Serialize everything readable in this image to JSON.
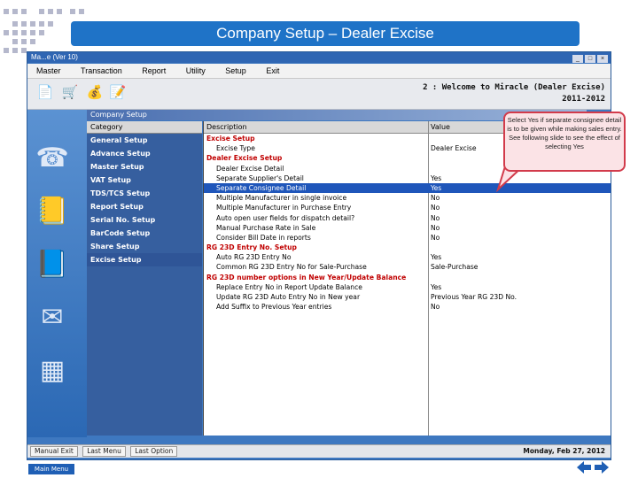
{
  "slide": {
    "title": "Company Setup – Dealer Excise",
    "main_menu_label": "Main Menu"
  },
  "window": {
    "title": "Ma...e (Ver 10)",
    "controls": [
      "_",
      "□",
      "×"
    ]
  },
  "menubar": [
    "Master",
    "Transaction",
    "Report",
    "Utility",
    "Setup",
    "Exit"
  ],
  "toolbar": {
    "icons": [
      "document-icon",
      "cart-icon",
      "money-bag-icon",
      "notepad-icon"
    ],
    "welcome_line1": "2 : Welcome to Miracle (Dealer Excise)",
    "welcome_line2": "2011-2012"
  },
  "panel": {
    "title": "Company Setup",
    "category_header": "Category",
    "description_header": "Description",
    "value_header": "Value"
  },
  "categories": [
    {
      "label": "General Setup",
      "selected": false
    },
    {
      "label": "Advance Setup",
      "selected": false
    },
    {
      "label": "Master Setup",
      "selected": false
    },
    {
      "label": "VAT Setup",
      "selected": false
    },
    {
      "label": "TDS/TCS Setup",
      "selected": false
    },
    {
      "label": "Report Setup",
      "selected": false
    },
    {
      "label": "Serial No. Setup",
      "selected": false
    },
    {
      "label": "BarCode Setup",
      "selected": false
    },
    {
      "label": "Share Setup",
      "selected": false
    },
    {
      "label": "Excise Setup",
      "selected": true
    }
  ],
  "rows": [
    {
      "description": "Excise Setup",
      "value": "",
      "section": true,
      "selected": false
    },
    {
      "description": "Excise Type",
      "value": "Dealer Excise",
      "section": false,
      "selected": false
    },
    {
      "description": "Dealer Excise Setup",
      "value": "",
      "section": true,
      "selected": false
    },
    {
      "description": "Dealer Excise Detail",
      "value": "",
      "section": false,
      "selected": false
    },
    {
      "description": "Separate Supplier's Detail",
      "value": "Yes",
      "section": false,
      "selected": false
    },
    {
      "description": "Separate Consignee Detail",
      "value": "Yes",
      "section": false,
      "selected": true
    },
    {
      "description": "Multiple Manufacturer in single invoice",
      "value": "No",
      "section": false,
      "selected": false
    },
    {
      "description": "Multiple Manufacturer in Purchase Entry",
      "value": "No",
      "section": false,
      "selected": false
    },
    {
      "description": "Auto open user fields for dispatch detail?",
      "value": "No",
      "section": false,
      "selected": false
    },
    {
      "description": "Manual Purchase Rate in Sale",
      "value": "No",
      "section": false,
      "selected": false
    },
    {
      "description": "Consider Bill Date in reports",
      "value": "No",
      "section": false,
      "selected": false
    },
    {
      "description": "RG 23D Entry No. Setup",
      "value": "",
      "section": true,
      "selected": false
    },
    {
      "description": "Auto RG 23D Entry No",
      "value": "Yes",
      "section": false,
      "selected": false
    },
    {
      "description": "Common RG 23D Entry No for Sale-Purchase",
      "value": "Sale-Purchase",
      "section": false,
      "selected": false
    },
    {
      "description": "RG 23D number options in New Year/Update Balance",
      "value": "",
      "section": true,
      "selected": false
    },
    {
      "description": "Replace Entry No in Report Update Balance",
      "value": "Yes",
      "section": false,
      "selected": false
    },
    {
      "description": "Update RG 23D Auto Entry No in New year",
      "value": "Previous Year RG 23D No.",
      "section": false,
      "selected": false
    },
    {
      "description": "Add Suffix to Previous Year entries",
      "value": "No",
      "section": false,
      "selected": false
    }
  ],
  "statusbar": {
    "buttons": [
      "Manual Exit",
      "Last Menu",
      "Last Option"
    ],
    "date": "Monday, Feb 27, 2012"
  },
  "callout": {
    "text": "Select Yes if separate consignee detail is to be given while making sales entry. See following slide to see the effect of selecting Yes"
  },
  "colors": {
    "banner": "#1f73c7",
    "window_blue": "#3e78c0",
    "selected_row": "#1f56ba",
    "section_text": "#c00000",
    "callout_border": "#d23b4b",
    "callout_fill": "#fbe3e6"
  }
}
